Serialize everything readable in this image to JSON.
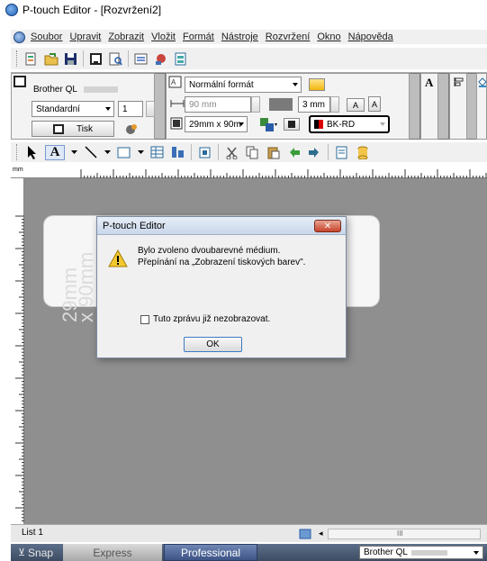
{
  "window": {
    "title": "P-touch Editor - [Rozvržení2]"
  },
  "menu": {
    "items": [
      "Soubor",
      "Upravit",
      "Zobrazit",
      "Vložit",
      "Formát",
      "Nástroje",
      "Rozvržení",
      "Okno",
      "Nápověda"
    ]
  },
  "properties": {
    "printer_name": "Brother QL",
    "print_mode": "Standardní",
    "copies": "1",
    "print_button": "Tisk",
    "format": "Normální formát",
    "length": "90 mm",
    "margin": "3 mm",
    "media_size": "29mm x 90m",
    "tape_color": "BK-RD"
  },
  "ruler": {
    "unit": "mm"
  },
  "canvas": {
    "label_text": "29mm\nx 90mm"
  },
  "sheet_tab": "List 1",
  "statusbar": {
    "snap": "Snap",
    "express": "Express",
    "professional": "Professional",
    "printer": "Brother QL"
  },
  "dialog": {
    "title": "P-touch Editor",
    "message_line1": "Bylo zvoleno dvoubarevné médium.",
    "message_line2": "Přepínání na „Zobrazení tiskových barev\".",
    "checkbox_label": "Tuto zprávu již nezobrazovat.",
    "ok_label": "OK",
    "close_symbol": "✕"
  }
}
